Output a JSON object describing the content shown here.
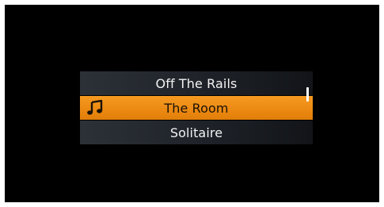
{
  "playlist": {
    "items": [
      {
        "label": "Off The Rails",
        "selected": false
      },
      {
        "label": "The Room",
        "selected": true,
        "icon": "music-note-icon"
      },
      {
        "label": "Solitaire",
        "selected": false
      }
    ]
  },
  "colors": {
    "highlight": "#ec8a12",
    "row_background": "#1e2228",
    "screen_background": "#000000"
  }
}
